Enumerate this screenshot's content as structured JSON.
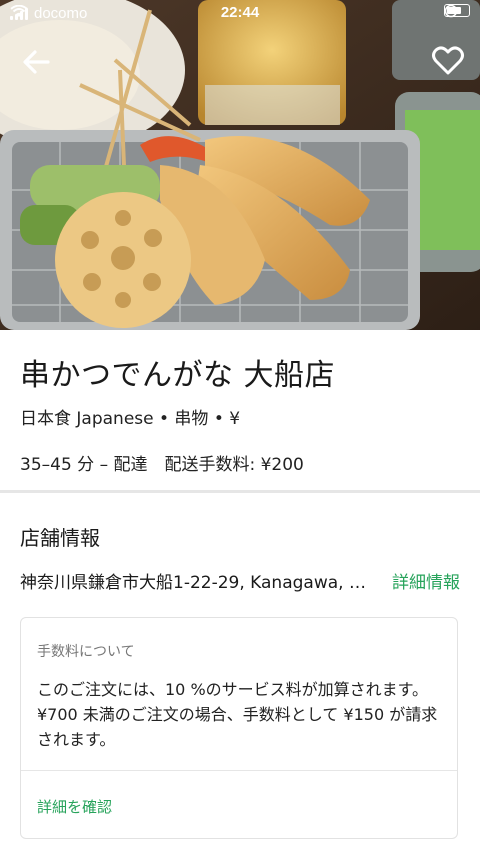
{
  "status_bar": {
    "carrier": "docomo",
    "time": "22:44"
  },
  "hero": {
    "back_icon": "arrow-left-icon",
    "favorite_icon": "heart-outline-icon"
  },
  "restaurant": {
    "name": "串かつでんがな 大船店",
    "categories": "日本食 Japanese • 串物 • ¥",
    "delivery_info": "35–45 分 – 配達　配送手数料: ¥200"
  },
  "store_info": {
    "title": "店舗情報",
    "address": "神奈川県鎌倉市大船1-22-29, Kanagawa, 2...",
    "details_link": "詳細情報"
  },
  "fee_notice": {
    "heading": "手数料について",
    "body": "このご注文には、10 %のサービス料が加算されます。¥700 未満のご注文の場合、手数料として ¥150 が請求されます。",
    "confirm_link": "詳細を確認"
  },
  "colors": {
    "accent": "#27a35b"
  }
}
